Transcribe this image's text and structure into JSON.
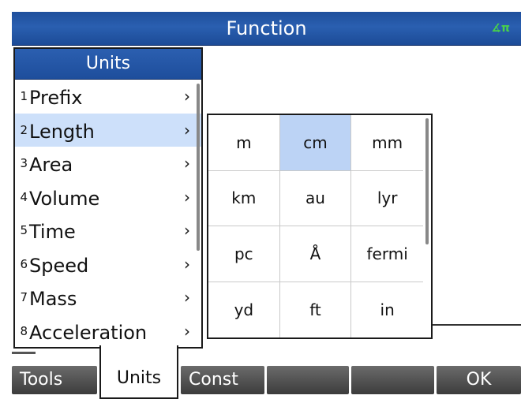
{
  "app": {
    "title": "Function",
    "angle_indicator": "∡π"
  },
  "units_menu": {
    "title": "Units",
    "items": [
      {
        "num": "1",
        "label": "Prefix",
        "arrow": "›"
      },
      {
        "num": "2",
        "label": "Length",
        "arrow": "›"
      },
      {
        "num": "3",
        "label": "Area",
        "arrow": "›"
      },
      {
        "num": "4",
        "label": "Volume",
        "arrow": "›"
      },
      {
        "num": "5",
        "label": "Time",
        "arrow": "›"
      },
      {
        "num": "6",
        "label": "Speed",
        "arrow": "›"
      },
      {
        "num": "7",
        "label": "Mass",
        "arrow": "›"
      },
      {
        "num": "8",
        "label": "Acceleration",
        "arrow": "›"
      }
    ],
    "selected_index": 1
  },
  "length_grid": {
    "cells": [
      "m",
      "cm",
      "mm",
      "km",
      "au",
      "lyr",
      "pc",
      "Å",
      "fermi",
      "yd",
      "ft",
      "in"
    ],
    "selected_index": 1
  },
  "softmenu": {
    "keys": [
      "Tools",
      "Units",
      "Const",
      "",
      "",
      "OK"
    ]
  },
  "colors": {
    "title_bar": "#1f4f9c",
    "selection": "#cde0fa",
    "softkey": "#4a4a4a",
    "angle_indicator": "#49d24a"
  }
}
